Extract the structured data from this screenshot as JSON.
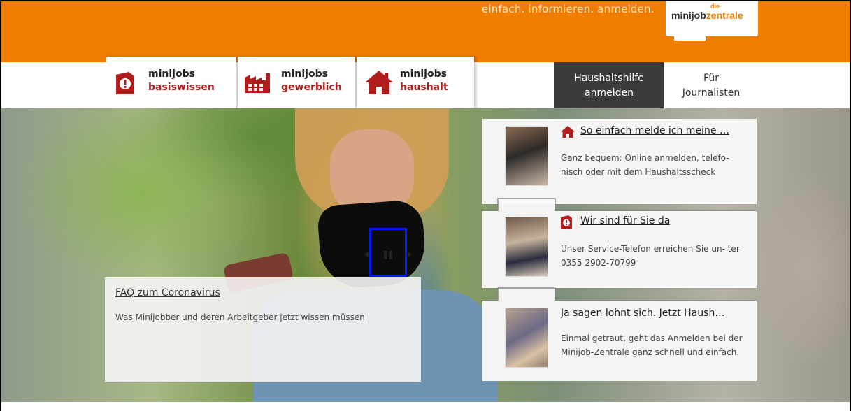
{
  "header": {
    "tagline": "einfach. informieren. anmelden.",
    "logo": {
      "part1": "minijob",
      "part2": "zentrale",
      "sup": "die"
    },
    "accent": "#ef7d00"
  },
  "nav": {
    "tabs": [
      {
        "line1": "minijobs",
        "line2": "basiswissen",
        "icon": "info-document-icon"
      },
      {
        "line1": "minijobs",
        "line2": "gewerblich",
        "icon": "factory-icon"
      },
      {
        "line1": "minijobs",
        "line2": "haushalt",
        "icon": "house-icon"
      }
    ],
    "register_button": {
      "line1": "Haushaltshilfe",
      "line2": "anmelden"
    },
    "journalists_link": {
      "line1": "Für",
      "line2": "Journalisten"
    }
  },
  "hero": {
    "faq": {
      "title": "FAQ zum Coronavirus",
      "text": "Was Minijobber und deren Arbeitgeber jetzt wissen müssen"
    },
    "cards": [
      {
        "title": "So einfach melde ich meine …",
        "icon": "house-icon",
        "desc": "Ganz bequem: Online anmelden, telefo- nisch oder mit dem Haushaltsscheck"
      },
      {
        "title": "Wir sind für Sie da",
        "icon": "info-document-icon",
        "desc": "Unser Service-Telefon erreichen Sie un- ter 0355 2902-70799"
      },
      {
        "title": "Ja sagen lohnt sich. Jetzt Haush…",
        "icon": "",
        "desc": "Einmal getraut, geht das Anmelden bei der Minijob-Zentrale ganz schnell und einfach."
      }
    ]
  },
  "colors": {
    "brand_red": "#b01d1d",
    "dark_button": "#3b3b3b",
    "highlight": "#0019ff"
  }
}
